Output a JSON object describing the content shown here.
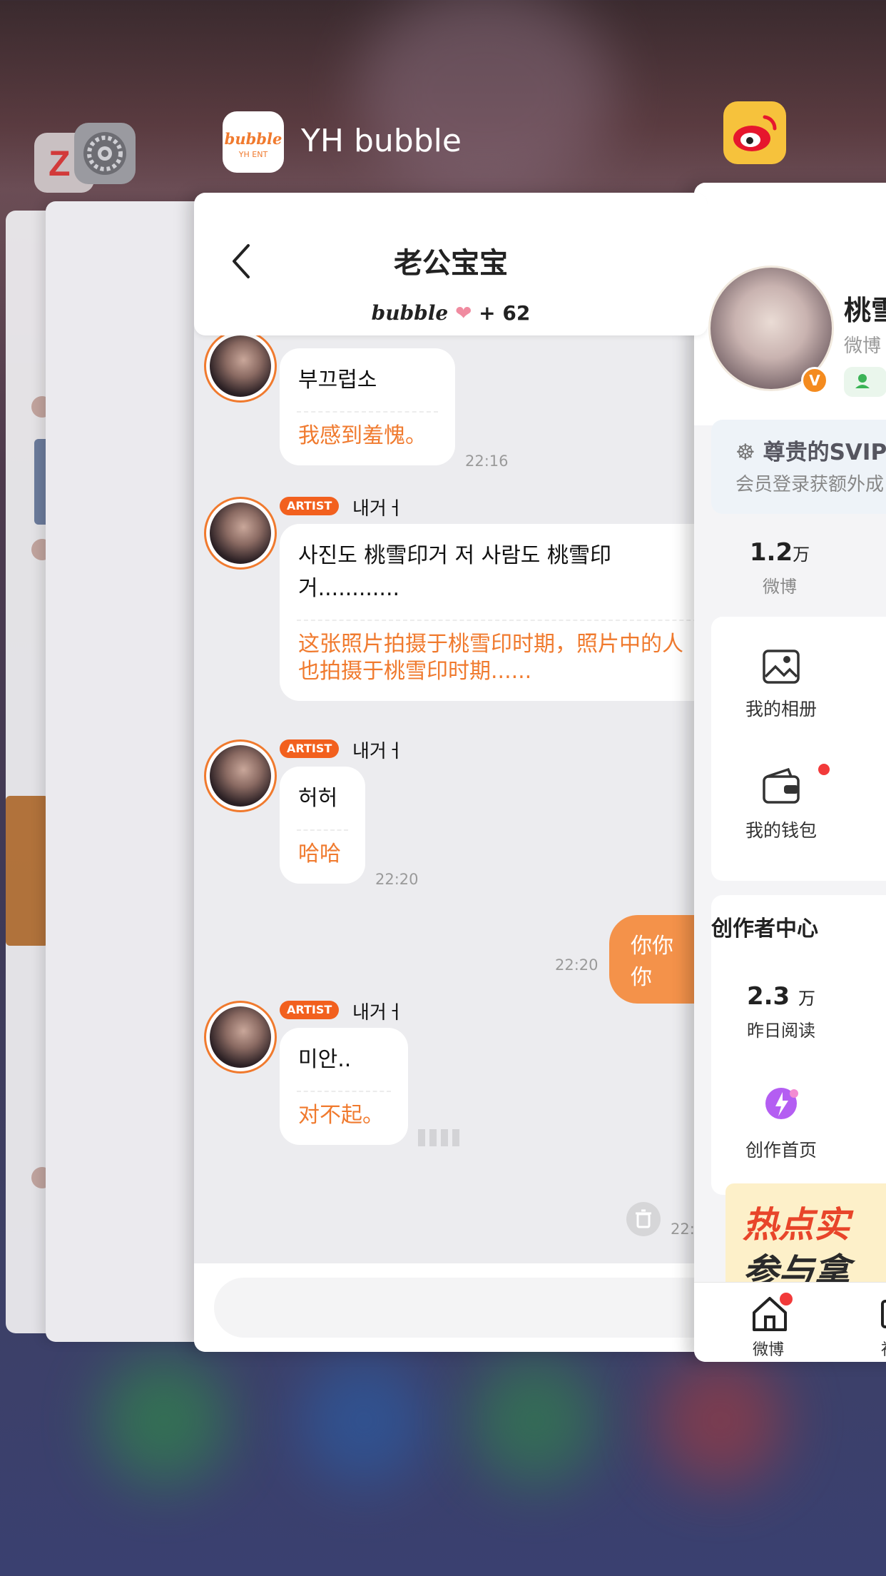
{
  "switcher": {
    "bubble_icon_text": "bubble",
    "bubble_icon_sub": "YH ENT",
    "bubble_app_title": "YH bubble"
  },
  "chat": {
    "title": "老公宝宝",
    "subtitle_brand": "bubble",
    "subtitle_count": "+ 62",
    "artist_tag": "ARTIST",
    "messages": [
      {
        "sender": "",
        "kr": "부끄럽소",
        "cn": "我感到羞愧。",
        "time": "22:16"
      },
      {
        "sender": "내거ㅓ",
        "kr": "사진도 桃雪印거 저 사람도 桃雪印 거............",
        "cn": "这张照片拍摄于桃雪印时期，照片中的人也拍摄于桃雪印时期......",
        "time": ""
      },
      {
        "sender": "내거ㅓ",
        "kr": "허허",
        "cn": "哈哈",
        "time": "22:20"
      },
      {
        "sender": "내거ㅓ",
        "kr": "미안..",
        "cn": "对不起。",
        "time": ""
      }
    ],
    "my_message": {
      "text": "你你你",
      "time": "22:20"
    },
    "last_time": "22:"
  },
  "weibo": {
    "name": "桃雪",
    "sub": "微博",
    "v_badge": "V",
    "svip_title": "尊贵的SVIP",
    "svip_sub": "会员登录获额外成",
    "stat_weibo_num": "1.2",
    "stat_weibo_unit": "万",
    "stat_weibo_label": "微博",
    "album_label": "我的相册",
    "wallet_label": "我的钱包",
    "creator_title": "创作者中心",
    "reads_num": "2.3",
    "reads_unit": "万",
    "reads_label": "昨日阅读",
    "creator_home_label": "创作首页",
    "banner_line1": "热点实",
    "banner_line2": "参与拿",
    "tab_home": "微博",
    "tab_second": "社"
  },
  "colors": {
    "accent_orange": "#f07a2e",
    "artist_tag": "#f2601e",
    "weibo_red": "#e6162d"
  }
}
